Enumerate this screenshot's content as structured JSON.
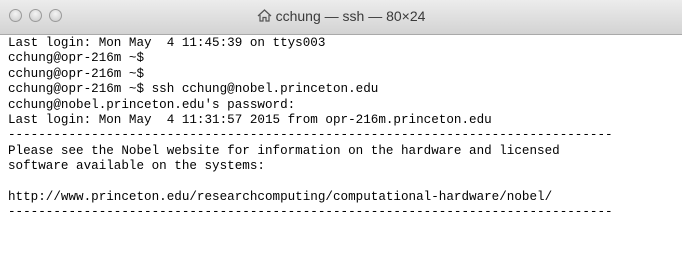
{
  "window": {
    "title": "cchung — ssh — 80×24",
    "title_icon": "home-icon"
  },
  "terminal": {
    "lines": [
      "Last login: Mon May  4 11:45:39 on ttys003",
      "cchung@opr-216m ~$",
      "cchung@opr-216m ~$",
      "cchung@opr-216m ~$ ssh cchung@nobel.princeton.edu",
      "cchung@nobel.princeton.edu's password:",
      "Last login: Mon May  4 11:31:57 2015 from opr-216m.princeton.edu",
      "--------------------------------------------------------------------------------",
      "Please see the Nobel website for information on the hardware and licensed",
      "software available on the systems:",
      "",
      "http://www.princeton.edu/researchcomputing/computational-hardware/nobel/",
      "--------------------------------------------------------------------------------"
    ]
  }
}
